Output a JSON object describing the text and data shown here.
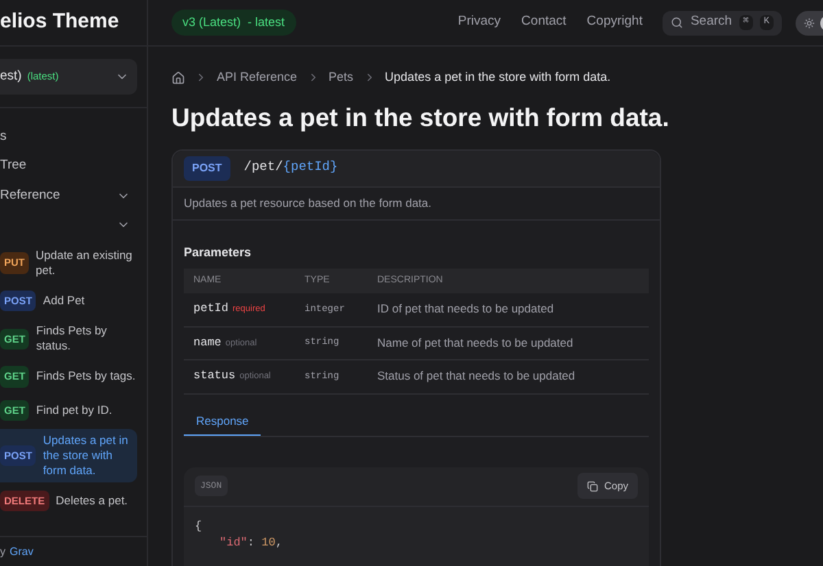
{
  "header": {
    "site_title": "elios Theme",
    "version_badge": "v3 (Latest)  - latest",
    "nav": [
      "Privacy",
      "Contact",
      "Copyright"
    ],
    "search": {
      "placeholder": "Search",
      "keys": [
        "⌘",
        "K"
      ]
    },
    "theme_toggle": {
      "on": true
    }
  },
  "sidebar": {
    "version_select": {
      "value": "est)",
      "tag": "(latest)"
    },
    "items": [
      {
        "label": "s",
        "kind": "link"
      },
      {
        "label": "Tree",
        "kind": "link"
      },
      {
        "label": "Reference",
        "kind": "group",
        "expanded": true
      },
      {
        "kind": "group",
        "expanded": true
      }
    ],
    "endpoints": [
      {
        "method": "PUT",
        "kind": "put",
        "label": "Update an existing pet.",
        "selected": false
      },
      {
        "method": "POST",
        "kind": "post",
        "label": "Add Pet",
        "selected": false
      },
      {
        "method": "GET",
        "kind": "get",
        "label": "Finds Pets by status.",
        "selected": false
      },
      {
        "method": "GET",
        "kind": "get",
        "label": "Finds Pets by tags.",
        "selected": false
      },
      {
        "method": "GET",
        "kind": "get",
        "label": "Find pet by ID.",
        "selected": false
      },
      {
        "method": "POST",
        "kind": "post",
        "label": "Updates a pet in the store with form data.",
        "selected": true
      },
      {
        "method": "DELETE",
        "kind": "delete",
        "label": "Deletes a pet.",
        "selected": false
      }
    ],
    "footer": {
      "text": "y",
      "link": "Grav"
    }
  },
  "breadcrumb": [
    "API Reference",
    "Pets",
    "Updates a pet in the store with form data."
  ],
  "title": "Updates a pet in the store with form data.",
  "endpoint": {
    "method": "POST",
    "path": "/pet/",
    "param": "{petId}",
    "description": "Updates a pet resource based on the form data."
  },
  "parameters": {
    "heading": "Parameters",
    "columns": [
      "NAME",
      "TYPE",
      "DESCRIPTION"
    ],
    "rows": [
      {
        "name": "petId",
        "flag": "required",
        "required": true,
        "type": "integer",
        "description": "ID of pet that needs to be updated"
      },
      {
        "name": "name",
        "flag": "optional",
        "required": false,
        "type": "string",
        "description": "Name of pet that needs to be updated"
      },
      {
        "name": "status",
        "flag": "optional",
        "required": false,
        "type": "string",
        "description": "Status of pet that needs to be updated"
      }
    ]
  },
  "tabs": [
    {
      "label": "Response",
      "selected": true
    }
  ],
  "code": {
    "language": "JSON",
    "copy": "Copy",
    "lines": [
      [
        {
          "kind": "punct",
          "text": "{"
        }
      ],
      [
        {
          "kind": "key",
          "text": "\"id\""
        },
        {
          "kind": "punct",
          "text": ": "
        },
        {
          "kind": "number",
          "text": "10"
        },
        {
          "kind": "punct",
          "text": ","
        }
      ]
    ]
  }
}
